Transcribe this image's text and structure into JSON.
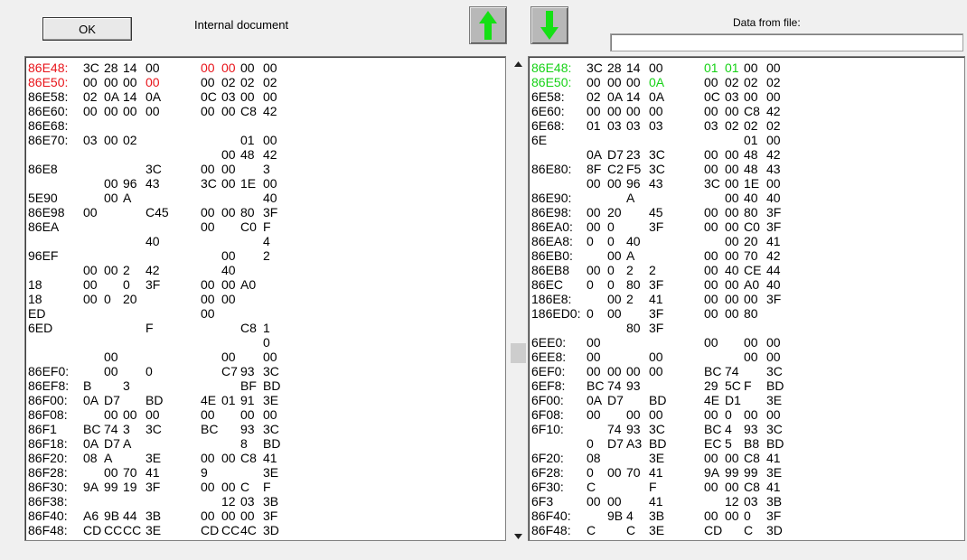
{
  "header": {
    "ok_label": "OK",
    "internal_label": "Internal document",
    "file_label": "Data from file:",
    "file_path": ""
  },
  "icons": {
    "up": "up-arrow-icon",
    "down": "down-arrow-icon",
    "arrow_color": "#15e015"
  },
  "colors": {
    "diff_internal": "#e8141a",
    "diff_file": "#16d216"
  },
  "internal_rows": [
    {
      "addr": "86E48:",
      "bytes": [
        "3C",
        "28",
        "14",
        "00",
        "00",
        "00",
        "00",
        "00"
      ],
      "hl": [
        4,
        5
      ]
    },
    {
      "addr": "86E50:",
      "bytes": [
        "00",
        "00",
        "00",
        "00",
        "00",
        "02",
        "02",
        "02"
      ],
      "hl": [
        3
      ]
    },
    {
      "addr": "86E58:",
      "bytes": [
        "02",
        "0A",
        "14",
        "0A",
        "0C",
        "03",
        "00",
        "00"
      ],
      "hl": []
    },
    {
      "addr": "86E60:",
      "bytes": [
        "00",
        "00",
        "00",
        "00",
        "00",
        "00",
        "C8",
        "42"
      ],
      "hl": []
    },
    {
      "addr": "86E68:",
      "bytes": [
        "",
        "",
        "",
        "",
        "",
        "",
        "",
        ""
      ],
      "hl": []
    },
    {
      "addr": "86E70:",
      "bytes": [
        "03",
        "00",
        "02",
        "",
        "",
        "",
        "01",
        "00"
      ],
      "hl": []
    },
    {
      "addr": "",
      "bytes": [
        "",
        "",
        "",
        "",
        "",
        "00",
        "48",
        "42"
      ],
      "hl": []
    },
    {
      "addr": "86E8",
      "bytes": [
        "",
        "",
        "",
        "3C",
        "00",
        "00",
        "",
        "3"
      ],
      "hl": []
    },
    {
      "addr": "",
      "bytes": [
        "",
        "00",
        "96",
        "43",
        "3C",
        "00",
        "1E",
        "00"
      ],
      "hl": []
    },
    {
      "addr": "5E90",
      "bytes": [
        "",
        "00",
        "A",
        "",
        "",
        "",
        "",
        "40"
      ],
      "hl": []
    },
    {
      "addr": "86E98",
      "bytes": [
        "00",
        "",
        "",
        "C45",
        "00",
        "00",
        "80",
        "3F"
      ],
      "hl": []
    },
    {
      "addr": "86EA",
      "bytes": [
        "",
        "",
        "",
        "",
        "00",
        "",
        "C0",
        "F"
      ],
      "hl": []
    },
    {
      "addr": "",
      "bytes": [
        "",
        "",
        "",
        "40",
        "",
        "",
        "",
        "4"
      ],
      "hl": []
    },
    {
      "addr": "96EF",
      "bytes": [
        "",
        "",
        "",
        "",
        "",
        "00",
        "",
        "2"
      ],
      "hl": []
    },
    {
      "addr": "",
      "bytes": [
        "00",
        "00",
        "2",
        "42",
        "",
        "40",
        "",
        ""
      ],
      "hl": []
    },
    {
      "addr": "18",
      "bytes": [
        "00",
        "",
        "0",
        "3F",
        "00",
        "00",
        "A0",
        ""
      ],
      "hl": []
    },
    {
      "addr": "18",
      "bytes": [
        "00",
        "0",
        "20",
        "",
        "00",
        "00",
        "",
        ""
      ],
      "hl": []
    },
    {
      "addr": "ED",
      "bytes": [
        "",
        "",
        "",
        "",
        "00",
        "",
        "",
        ""
      ],
      "hl": []
    },
    {
      "addr": "6ED",
      "bytes": [
        "",
        "",
        "",
        "F",
        "",
        "",
        "C8",
        "1"
      ],
      "hl": []
    },
    {
      "addr": "",
      "bytes": [
        "",
        "",
        "",
        "",
        "",
        "",
        "",
        "0"
      ],
      "hl": []
    },
    {
      "addr": "",
      "bytes": [
        "",
        "00",
        "",
        "",
        "",
        "00",
        "",
        "00"
      ],
      "hl": []
    },
    {
      "addr": "86EF0:",
      "bytes": [
        "",
        "00",
        "",
        "0",
        "",
        "C7",
        "93",
        "3C"
      ],
      "hl": []
    },
    {
      "addr": "86EF8:",
      "bytes": [
        "B",
        "",
        "3",
        "",
        "",
        "",
        "BF",
        "BD"
      ],
      "hl": []
    },
    {
      "addr": "86F00:",
      "bytes": [
        "0A",
        "D7",
        "",
        "BD",
        "4E",
        "01",
        "91",
        "3E"
      ],
      "hl": []
    },
    {
      "addr": "86F08:",
      "bytes": [
        "",
        "00",
        "00",
        "00",
        "00",
        "",
        "00",
        "00"
      ],
      "hl": []
    },
    {
      "addr": "86F1",
      "bytes": [
        "BC",
        "74",
        "3",
        "3C",
        "BC",
        "",
        "93",
        "3C"
      ],
      "hl": []
    },
    {
      "addr": "86F18:",
      "bytes": [
        "0A",
        "D7",
        "A",
        "",
        "",
        "",
        "8",
        "BD"
      ],
      "hl": []
    },
    {
      "addr": "86F20:",
      "bytes": [
        "08",
        "A",
        "",
        "3E",
        "00",
        "00",
        "C8",
        "41"
      ],
      "hl": []
    },
    {
      "addr": "86F28:",
      "bytes": [
        "",
        "00",
        "70",
        "41",
        "9",
        "",
        "",
        "3E"
      ],
      "hl": []
    },
    {
      "addr": "86F30:",
      "bytes": [
        "9A",
        "99",
        "19",
        "3F",
        "00",
        "00",
        "C",
        "F"
      ],
      "hl": []
    },
    {
      "addr": "86F38:",
      "bytes": [
        "",
        "",
        "",
        "",
        "",
        "12",
        "03",
        "3B"
      ],
      "hl": []
    },
    {
      "addr": "86F40:",
      "bytes": [
        "A6",
        "9B",
        "44",
        "3B",
        "00",
        "00",
        "00",
        "3F"
      ],
      "hl": []
    },
    {
      "addr": "86F48:",
      "bytes": [
        "CD",
        "CC",
        "CC",
        "3E",
        "CD",
        "CC",
        "4C",
        "3D"
      ],
      "hl": []
    }
  ],
  "file_rows": [
    {
      "addr": "86E48:",
      "bytes": [
        "3C",
        "28",
        "14",
        "00",
        "01",
        "01",
        "00",
        "00"
      ],
      "hl": [
        4,
        5
      ]
    },
    {
      "addr": "86E50:",
      "bytes": [
        "00",
        "00",
        "00",
        "0A",
        "00",
        "02",
        "02",
        "02"
      ],
      "hl": [
        3
      ]
    },
    {
      "addr": "6E58:",
      "bytes": [
        "02",
        "0A",
        "14",
        "0A",
        "0C",
        "03",
        "00",
        "00"
      ],
      "hl": []
    },
    {
      "addr": "6E60:",
      "bytes": [
        "00",
        "00",
        "00",
        "00",
        "00",
        "00",
        "C8",
        "42"
      ],
      "hl": []
    },
    {
      "addr": "6E68:",
      "bytes": [
        "01",
        "03",
        "03",
        "03",
        "03",
        "02",
        "02",
        "02"
      ],
      "hl": []
    },
    {
      "addr": "6E",
      "bytes": [
        "",
        "",
        "",
        "",
        "",
        "",
        "01",
        "00"
      ],
      "hl": []
    },
    {
      "addr": "",
      "bytes": [
        "0A",
        "D7",
        "23",
        "3C",
        "00",
        "00",
        "48",
        "42"
      ],
      "hl": []
    },
    {
      "addr": "86E80:",
      "bytes": [
        "8F",
        "C2",
        "F5",
        "3C",
        "00",
        "00",
        "48",
        "43"
      ],
      "hl": []
    },
    {
      "addr": "",
      "bytes": [
        "00",
        "00",
        "96",
        "43",
        "3C",
        "00",
        "1E",
        "00"
      ],
      "hl": []
    },
    {
      "addr": "86E90:",
      "bytes": [
        "",
        "",
        "A",
        "",
        "",
        "00",
        "40",
        "40"
      ],
      "hl": []
    },
    {
      "addr": "86E98:",
      "bytes": [
        "00",
        "20",
        "",
        "45",
        "00",
        "00",
        "80",
        "3F"
      ],
      "hl": []
    },
    {
      "addr": "86EA0:",
      "bytes": [
        "00",
        "0",
        "",
        "3F",
        "00",
        "00",
        "C0",
        "3F"
      ],
      "hl": []
    },
    {
      "addr": "86EA8:",
      "bytes": [
        "0",
        "0",
        "40",
        "",
        "",
        "00",
        "20",
        "41"
      ],
      "hl": []
    },
    {
      "addr": "86EB0:",
      "bytes": [
        "",
        "00",
        "A",
        "",
        "00",
        "00",
        "70",
        "42"
      ],
      "hl": []
    },
    {
      "addr": "86EB8",
      "bytes": [
        "00",
        "0",
        "2",
        "2",
        "00",
        "40",
        "CE",
        "44"
      ],
      "hl": []
    },
    {
      "addr": "86EC",
      "bytes": [
        "0",
        "0",
        "80",
        "3F",
        "00",
        "00",
        "A0",
        "40"
      ],
      "hl": []
    },
    {
      "addr": "186E8:",
      "bytes": [
        "",
        "00",
        "2",
        "41",
        "00",
        "00",
        "00",
        "3F"
      ],
      "hl": []
    },
    {
      "addr": "186ED0:",
      "bytes": [
        "0",
        "00",
        "",
        "3F",
        "00",
        "00",
        "80",
        ""
      ],
      "hl": []
    },
    {
      "addr": "",
      "bytes": [
        "",
        "",
        "80",
        "3F",
        "",
        "",
        "",
        ""
      ],
      "hl": []
    },
    {
      "addr": "6EE0:",
      "bytes": [
        "00",
        "",
        "",
        "",
        "00",
        "",
        "00",
        "00"
      ],
      "hl": []
    },
    {
      "addr": "6EE8:",
      "bytes": [
        "00",
        "",
        "",
        "00",
        "",
        "",
        "00",
        "00"
      ],
      "hl": []
    },
    {
      "addr": "6EF0:",
      "bytes": [
        "00",
        "00",
        "00",
        "00",
        "BC",
        "74",
        "",
        "3C"
      ],
      "hl": []
    },
    {
      "addr": "6EF8:",
      "bytes": [
        "BC",
        "74",
        "93",
        "",
        "29",
        "5C",
        "F",
        "BD"
      ],
      "hl": []
    },
    {
      "addr": "6F00:",
      "bytes": [
        "0A",
        "D7",
        "",
        "BD",
        "4E",
        "D1",
        "",
        "3E"
      ],
      "hl": []
    },
    {
      "addr": "6F08:",
      "bytes": [
        "00",
        "",
        "00",
        "00",
        "00",
        "0",
        "00",
        "00"
      ],
      "hl": []
    },
    {
      "addr": "6F10:",
      "bytes": [
        "",
        "74",
        "93",
        "3C",
        "BC",
        "4",
        "93",
        "3C"
      ],
      "hl": []
    },
    {
      "addr": "",
      "bytes": [
        "0",
        "D7",
        "A3",
        "BD",
        "EC",
        "5",
        "B8",
        "BD"
      ],
      "hl": []
    },
    {
      "addr": "6F20:",
      "bytes": [
        "08",
        "",
        "",
        "3E",
        "00",
        "00",
        "C8",
        "41"
      ],
      "hl": []
    },
    {
      "addr": "6F28:",
      "bytes": [
        "0",
        "00",
        "70",
        "41",
        "9A",
        "99",
        "99",
        "3E"
      ],
      "hl": []
    },
    {
      "addr": "6F30:",
      "bytes": [
        "C",
        "",
        "",
        "F",
        "00",
        "00",
        "C8",
        "41"
      ],
      "hl": []
    },
    {
      "addr": "6F3",
      "bytes": [
        "00",
        "00",
        "",
        "41",
        "",
        "12",
        "03",
        "3B"
      ],
      "hl": []
    },
    {
      "addr": "86F40:",
      "bytes": [
        "",
        "9B",
        "4",
        "3B",
        "00",
        "00",
        "0",
        "3F"
      ],
      "hl": []
    },
    {
      "addr": "86F48:",
      "bytes": [
        "C",
        "",
        "C",
        "3E",
        "CD",
        "",
        "C",
        "3D"
      ],
      "hl": []
    }
  ]
}
